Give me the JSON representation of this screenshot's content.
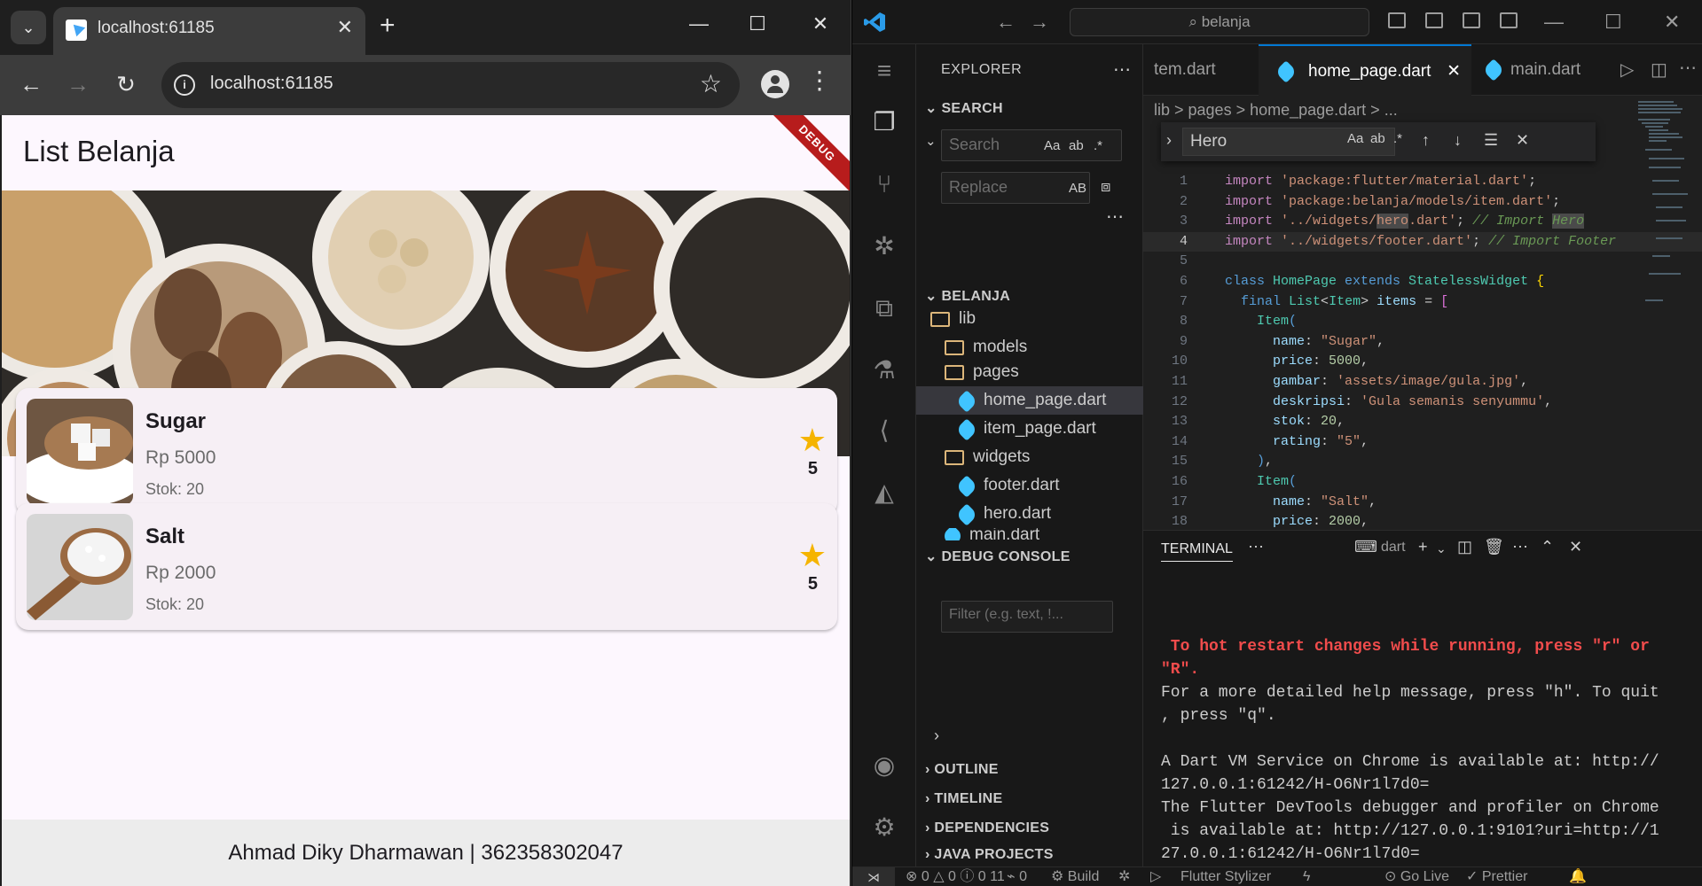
{
  "chrome": {
    "tab_title": "localhost:61185",
    "url": "localhost:61185",
    "new_tab": "+",
    "tab_close": "✕"
  },
  "app": {
    "title": "List Belanja",
    "debug_label": "DEBUG",
    "items": [
      {
        "name": "Sugar",
        "price": "Rp 5000",
        "stock": "Stok: 20",
        "rating": "5"
      },
      {
        "name": "Salt",
        "price": "Rp 2000",
        "stock": "Stok: 20",
        "rating": "5"
      }
    ],
    "footer": "Ahmad Diky Dharmawan | 362358302047"
  },
  "vscode": {
    "search_box": "belanja",
    "explorer_title": "EXPLORER",
    "search_section": "SEARCH",
    "search_placeholder": "Search",
    "replace_placeholder": "Replace",
    "search_opts": [
      "Aa",
      "ab",
      ".*"
    ],
    "replace_opt": "AB",
    "workspace": "BELANJA",
    "tree": [
      {
        "label": "lib",
        "type": "folder"
      },
      {
        "label": "models",
        "type": "folder"
      },
      {
        "label": "pages",
        "type": "folder"
      },
      {
        "label": "home_page.dart",
        "type": "dart"
      },
      {
        "label": "item_page.dart",
        "type": "dart"
      },
      {
        "label": "widgets",
        "type": "folder"
      },
      {
        "label": "footer.dart",
        "type": "dart"
      },
      {
        "label": "hero.dart",
        "type": "dart"
      },
      {
        "label": "main.dart",
        "type": "dart"
      }
    ],
    "debug_console": "DEBUG CONSOLE",
    "filter_placeholder": "Filter (e.g. text, !...",
    "outline_sections": [
      "OUTLINE",
      "TIMELINE",
      "DEPENDENCIES",
      "JAVA PROJECTS"
    ],
    "tabs": [
      "tem.dart",
      "home_page.dart",
      "main.dart"
    ],
    "breadcrumb": "lib > pages > home_page.dart > ...",
    "find_value": "Hero",
    "terminal_tab": "TERMINAL",
    "terminal_shell": "dart",
    "terminal_lines": [
      "",
      " To hot restart changes while running, press \"r\" or",
      "\"R\".",
      "For a more detailed help message, press \"h\". To quit",
      ", press \"q\".",
      "",
      "A Dart VM Service on Chrome is available at: http://",
      "127.0.0.1:61242/H-O6Nr1l7d0=",
      "The Flutter DevTools debugger and profiler on Chrome",
      " is available at: http://127.0.0.1:9101?uri=http://1",
      "27.0.0.1:61242/H-O6Nr1l7d0="
    ],
    "status": {
      "errors": "0",
      "warnings": "0",
      "info": "0",
      "ports": "11",
      "remote_count": "0",
      "build": "Build",
      "flutter_stylizer": "Flutter Stylizer",
      "go_live": "Go Live",
      "prettier": "Prettier"
    }
  },
  "code": [
    {
      "n": "1",
      "parts": [
        [
          "kw",
          "import "
        ],
        [
          "str",
          "'package:flutter/material.dart'"
        ],
        [
          "pn",
          ";"
        ]
      ]
    },
    {
      "n": "2",
      "parts": [
        [
          "kw",
          "import "
        ],
        [
          "str",
          "'package:belanja/models/item.dart'"
        ],
        [
          "pn",
          ";"
        ]
      ]
    },
    {
      "n": "3",
      "parts": [
        [
          "kw",
          "import "
        ],
        [
          "str",
          "'../widgets/"
        ],
        [
          "strhl",
          "hero"
        ],
        [
          "str",
          ".dart'"
        ],
        [
          "pn",
          "; "
        ],
        [
          "cm",
          "// Import "
        ],
        [
          "cmhl",
          "Hero"
        ]
      ]
    },
    {
      "n": "4",
      "parts": [
        [
          "kw",
          "import "
        ],
        [
          "str",
          "'../widgets/footer.dart'"
        ],
        [
          "pn",
          "; "
        ],
        [
          "cm",
          "// Import Footer"
        ]
      ]
    },
    {
      "n": "5",
      "parts": []
    },
    {
      "n": "6",
      "parts": [
        [
          "kw2",
          "class "
        ],
        [
          "ty",
          "HomePage "
        ],
        [
          "kw2",
          "extends "
        ],
        [
          "ty",
          "StatelessWidget "
        ],
        [
          "br1",
          "{"
        ]
      ]
    },
    {
      "n": "7",
      "parts": [
        [
          "pn",
          "  "
        ],
        [
          "kw2",
          "final "
        ],
        [
          "ty",
          "List"
        ],
        [
          "pn",
          "<"
        ],
        [
          "ty",
          "Item"
        ],
        [
          "pn",
          "> "
        ],
        [
          "prop",
          "items "
        ],
        [
          "pn",
          "= "
        ],
        [
          "br2",
          "["
        ]
      ]
    },
    {
      "n": "8",
      "parts": [
        [
          "pn",
          "    "
        ],
        [
          "ty",
          "Item"
        ],
        [
          "kw2",
          "("
        ]
      ]
    },
    {
      "n": "9",
      "parts": [
        [
          "pn",
          "      "
        ],
        [
          "prop",
          "name"
        ],
        [
          "pn",
          ": "
        ],
        [
          "str",
          "\"Sugar\""
        ],
        [
          "pn",
          ","
        ]
      ]
    },
    {
      "n": "10",
      "parts": [
        [
          "pn",
          "      "
        ],
        [
          "prop",
          "price"
        ],
        [
          "pn",
          ": "
        ],
        [
          "num",
          "5000"
        ],
        [
          "pn",
          ","
        ]
      ]
    },
    {
      "n": "11",
      "parts": [
        [
          "pn",
          "      "
        ],
        [
          "prop",
          "gambar"
        ],
        [
          "pn",
          ": "
        ],
        [
          "str",
          "'assets/image/gula.jpg'"
        ],
        [
          "pn",
          ","
        ]
      ]
    },
    {
      "n": "12",
      "parts": [
        [
          "pn",
          "      "
        ],
        [
          "prop",
          "deskripsi"
        ],
        [
          "pn",
          ": "
        ],
        [
          "str",
          "'Gula semanis senyummu'"
        ],
        [
          "pn",
          ","
        ]
      ]
    },
    {
      "n": "13",
      "parts": [
        [
          "pn",
          "      "
        ],
        [
          "prop",
          "stok"
        ],
        [
          "pn",
          ": "
        ],
        [
          "num",
          "20"
        ],
        [
          "pn",
          ","
        ]
      ]
    },
    {
      "n": "14",
      "parts": [
        [
          "pn",
          "      "
        ],
        [
          "prop",
          "rating"
        ],
        [
          "pn",
          ": "
        ],
        [
          "str",
          "\"5\""
        ],
        [
          "pn",
          ","
        ]
      ]
    },
    {
      "n": "15",
      "parts": [
        [
          "pn",
          "    "
        ],
        [
          "kw2",
          ")"
        ],
        [
          "pn",
          ","
        ]
      ]
    },
    {
      "n": "16",
      "parts": [
        [
          "pn",
          "    "
        ],
        [
          "ty",
          "Item"
        ],
        [
          "kw2",
          "("
        ]
      ]
    },
    {
      "n": "17",
      "parts": [
        [
          "pn",
          "      "
        ],
        [
          "prop",
          "name"
        ],
        [
          "pn",
          ": "
        ],
        [
          "str",
          "\"Salt\""
        ],
        [
          "pn",
          ","
        ]
      ]
    },
    {
      "n": "18",
      "parts": [
        [
          "pn",
          "      "
        ],
        [
          "prop",
          "price"
        ],
        [
          "pn",
          ": "
        ],
        [
          "num",
          "2000"
        ],
        [
          "pn",
          ","
        ]
      ]
    }
  ]
}
